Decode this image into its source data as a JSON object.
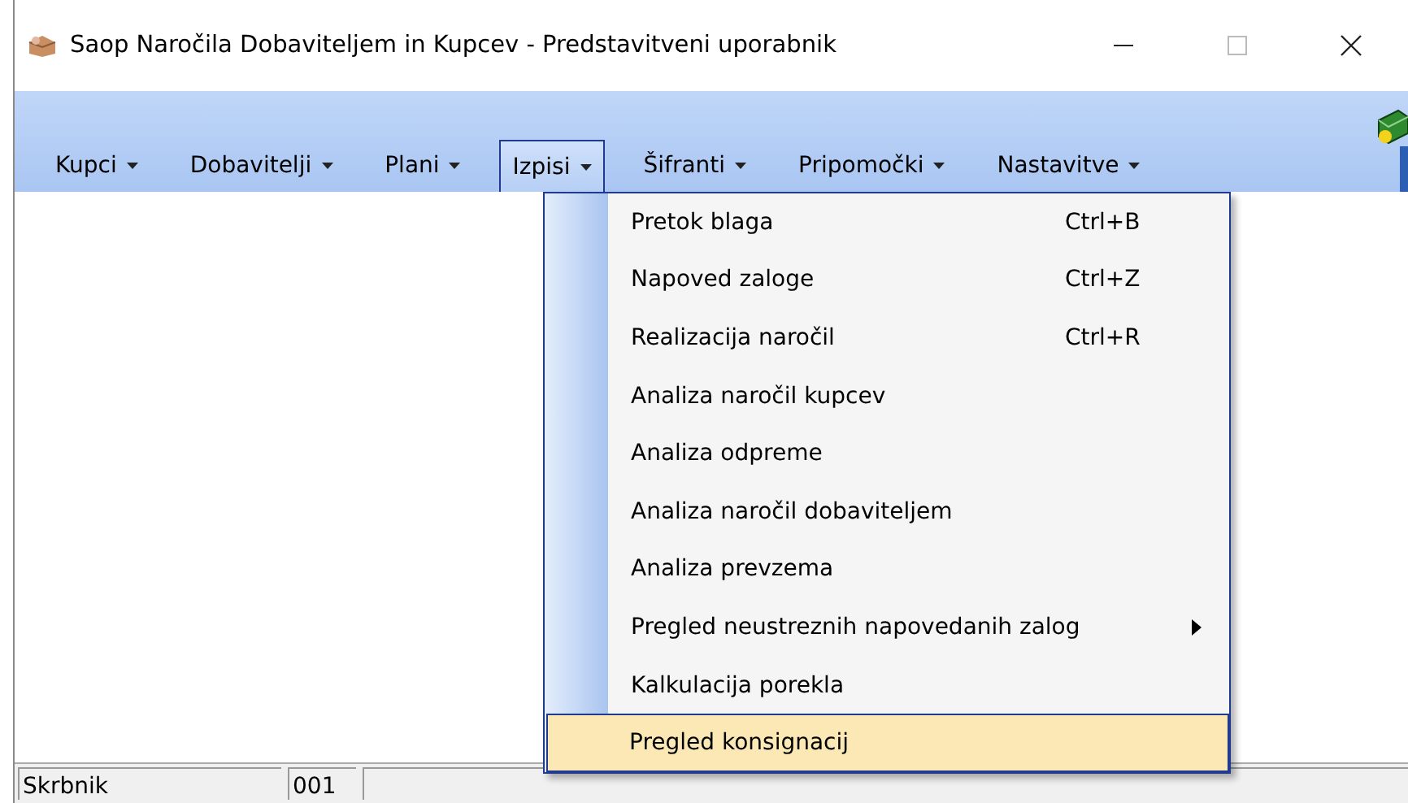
{
  "window": {
    "title": "Saop Naročila Dobaviteljem in Kupcev - Predstavitveni uporabnik"
  },
  "menu_bar": [
    {
      "label": "Kupci",
      "selected": false
    },
    {
      "label": "Dobavitelji",
      "selected": false
    },
    {
      "label": "Plani",
      "selected": false
    },
    {
      "label": "Izpisi",
      "selected": true
    },
    {
      "label": "Šifranti",
      "selected": false
    },
    {
      "label": "Pripomočki",
      "selected": false
    },
    {
      "label": "Nastavitve",
      "selected": false
    }
  ],
  "dropdown": {
    "items": [
      {
        "label": "Pretok blaga",
        "shortcut": "Ctrl+B",
        "has_submenu": false,
        "selected": false
      },
      {
        "label": "Napoved zaloge",
        "shortcut": "Ctrl+Z",
        "has_submenu": false,
        "selected": false
      },
      {
        "label": "Realizacija naročil",
        "shortcut": "Ctrl+R",
        "has_submenu": false,
        "selected": false
      },
      {
        "label": "Analiza naročil kupcev",
        "has_submenu": false,
        "selected": false
      },
      {
        "label": "Analiza odpreme",
        "has_submenu": false,
        "selected": false
      },
      {
        "label": "Analiza naročil dobaviteljem",
        "has_submenu": false,
        "selected": false
      },
      {
        "label": "Analiza prevzema",
        "has_submenu": false,
        "selected": false
      },
      {
        "label": "Pregled neustreznih napovedanih zalog",
        "has_submenu": true,
        "selected": false
      },
      {
        "label": "Kalkulacija porekla",
        "has_submenu": false,
        "selected": false
      },
      {
        "label": "Pregled konsignacij",
        "has_submenu": false,
        "selected": true
      }
    ]
  },
  "status_bar": {
    "fields": [
      "Skrbnik",
      "001"
    ]
  }
}
